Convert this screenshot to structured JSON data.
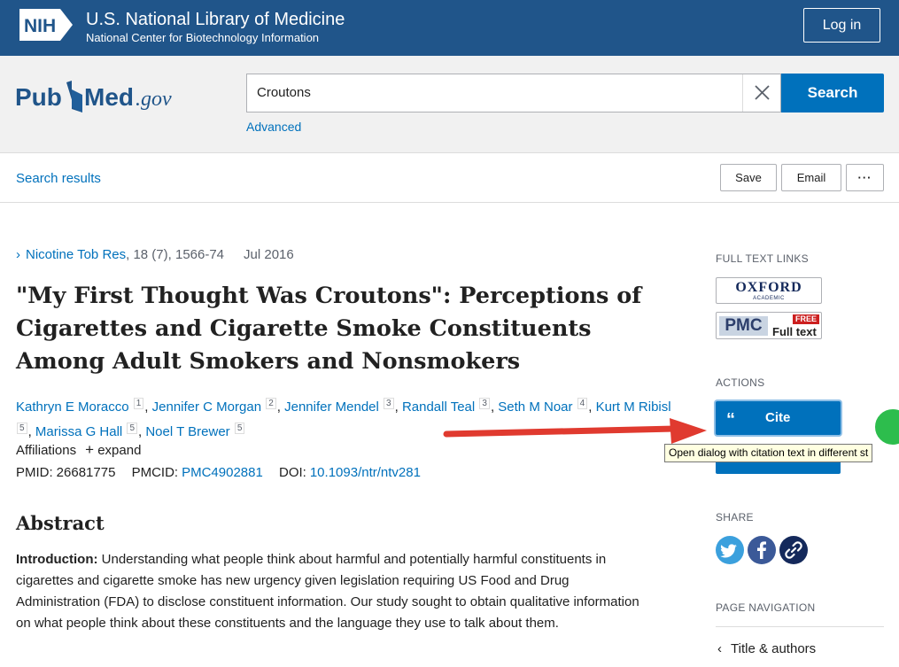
{
  "header": {
    "nih_logo_text": "NIH",
    "title": "U.S. National Library of Medicine",
    "subtitle": "National Center for Biotechnology Information",
    "login_label": "Log in"
  },
  "search": {
    "logo_text_pub": "Pub",
    "logo_text_med": "Med",
    "logo_text_gov": ".gov",
    "query": "Croutons",
    "button_label": "Search",
    "advanced_label": "Advanced"
  },
  "toolbar": {
    "back_label": "Search results",
    "save_label": "Save",
    "email_label": "Email",
    "more_label": "···"
  },
  "article": {
    "journal": "Nicotine Tob Res",
    "citation": ", 18 (7), 1566-74",
    "date": "Jul 2016",
    "title": "\"My First Thought Was Croutons\": Perceptions of Cigarettes and Cigarette Smoke Constituents Among Adult Smokers and Nonsmokers",
    "authors": [
      {
        "name": "Kathryn E Moracco",
        "aff": "1"
      },
      {
        "name": "Jennifer C Morgan",
        "aff": "2"
      },
      {
        "name": "Jennifer Mendel",
        "aff": "3"
      },
      {
        "name": "Randall Teal",
        "aff": "3"
      },
      {
        "name": "Seth M Noar",
        "aff": "4"
      },
      {
        "name": "Kurt M Ribisl",
        "aff": "5"
      },
      {
        "name": "Marissa G Hall",
        "aff": "5"
      },
      {
        "name": "Noel T Brewer",
        "aff": "5"
      }
    ],
    "affiliations_label": "Affiliations",
    "expand_label": "expand",
    "pmid_label": "PMID:",
    "pmid": "26681775",
    "pmcid_label": "PMCID:",
    "pmcid": "PMC4902881",
    "doi_label": "DOI:",
    "doi": "10.1093/ntr/ntv281",
    "abstract_heading": "Abstract",
    "abstract_intro_label": "Introduction:",
    "abstract_intro_text": " Understanding what people think about harmful and potentially harmful constituents in cigarettes and cigarette smoke has new urgency given legislation requiring US Food and Drug Administration (FDA) to disclose constituent information. Our study sought to obtain qualitative information on what people think about these constituents and the language they use to talk about them."
  },
  "sidebar": {
    "full_text_heading": "FULL TEXT LINKS",
    "oxford_label": "OXFORD",
    "oxford_sub": "ACADEMIC",
    "pmc_label": "PMC",
    "pmc_free": "FREE",
    "pmc_full_text": "Full text",
    "actions_heading": "ACTIONS",
    "cite_quote": "“",
    "cite_label": "Cite",
    "tooltip": "Open dialog with citation text in different st",
    "share_heading": "SHARE",
    "page_nav_heading": "PAGE NAVIGATION",
    "nav_item": "Title & authors"
  },
  "colors": {
    "nih_blue": "#20558a",
    "link_blue": "#0071bc",
    "annotation_arrow": "#e03a2f"
  }
}
